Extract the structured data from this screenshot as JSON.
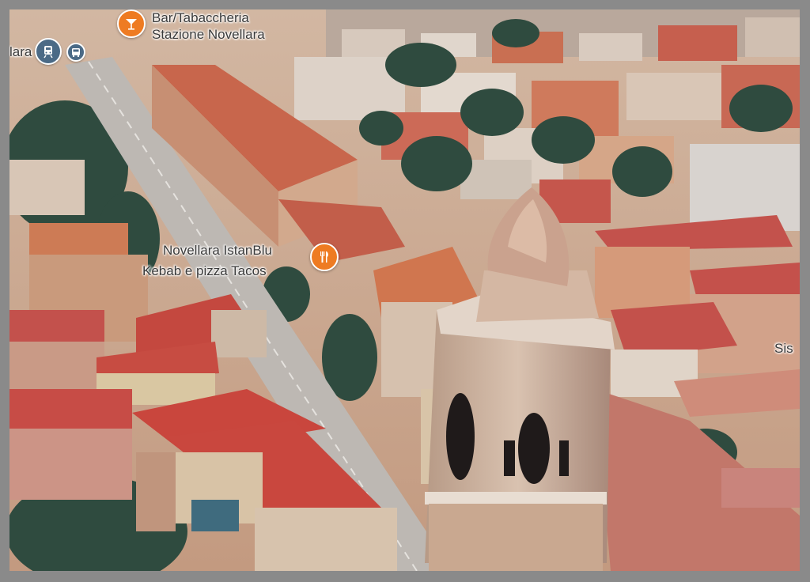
{
  "map": {
    "view": "3d-aerial",
    "labels": {
      "station_partial": "lara",
      "bar_line1": "Bar/Tabaccheria",
      "bar_line2": "Stazione Novellara",
      "restaurant_line1": "Novellara IstanBlu",
      "restaurant_line2": "Kebab e pizza Tacos",
      "edge_label": "Sis"
    },
    "icons": {
      "bar_pin": "cocktail-icon",
      "restaurant_pin": "fork-knife-icon",
      "train": "train-icon",
      "bus": "bus-icon"
    },
    "colors": {
      "poi_orange": "#ee7b22",
      "transit_blue": "#4b6a86",
      "roof_red": "#c8554a",
      "tree_green": "#2f4b3f",
      "road_gray": "#bdb8b3"
    }
  }
}
